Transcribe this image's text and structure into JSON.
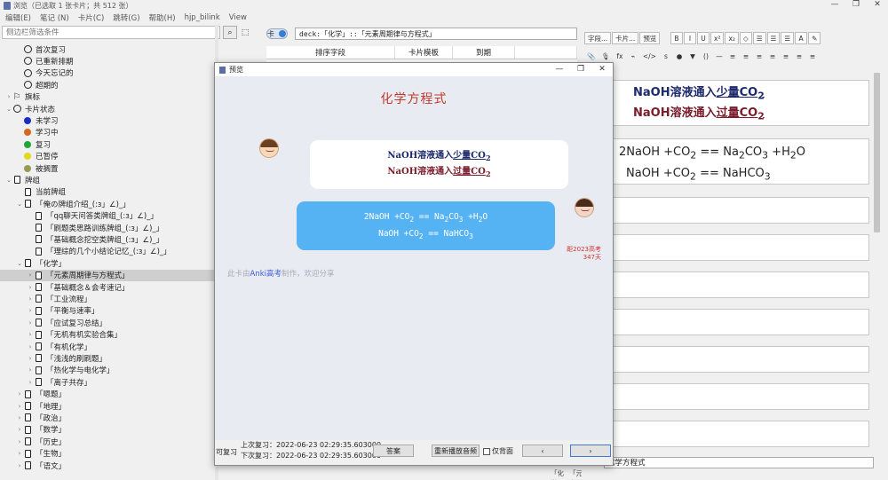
{
  "window": {
    "title": "浏览（已选取 1 张卡片；共 512 张）",
    "controls": [
      "—",
      "❐",
      "✕"
    ]
  },
  "menu": [
    "编辑(E)",
    "笔记 (N)",
    "卡片(C)",
    "跳转(G)",
    "帮助(H)",
    "hjp_bilink",
    "View"
  ],
  "search": {
    "placeholder": "侧边栏筛选条件"
  },
  "sidebar": {
    "items": [
      {
        "label": "首次复习",
        "icon": "clock-icon",
        "indent": 1
      },
      {
        "label": "已重新排期",
        "icon": "clock-icon",
        "indent": 1
      },
      {
        "label": "今天忘记的",
        "icon": "clock-icon",
        "indent": 1
      },
      {
        "label": "超期的",
        "icon": "clock-icon",
        "indent": 1
      },
      {
        "label": "旗标",
        "icon": "flag-icon",
        "indent": 0,
        "arrow": "›"
      },
      {
        "label": "卡片状态",
        "icon": "circle-icon",
        "indent": 0,
        "arrow": "⌄"
      },
      {
        "label": "未学习",
        "icon": "dot",
        "color": "#1a2fbf",
        "indent": 1
      },
      {
        "label": "学习中",
        "icon": "dot",
        "color": "#d9661f",
        "indent": 1
      },
      {
        "label": "复习",
        "icon": "dot",
        "color": "#1fa83a",
        "indent": 1
      },
      {
        "label": "已暂停",
        "icon": "dot",
        "color": "#e3d81a",
        "indent": 1
      },
      {
        "label": "被搁置",
        "icon": "dot",
        "color": "#9a9a55",
        "indent": 1
      },
      {
        "label": "牌组",
        "icon": "deck-icon",
        "indent": 0,
        "arrow": "⌄"
      },
      {
        "label": "当前牌组",
        "icon": "current-deck-icon",
        "indent": 1
      },
      {
        "label": "「俺の牌组介绍_(:з」∠)_」",
        "icon": "deck-icon",
        "indent": 1,
        "arrow": "⌄"
      },
      {
        "label": "「qq聊天问答类牌组_(:з」∠)_」",
        "icon": "deck-icon",
        "indent": 2
      },
      {
        "label": "「刷题类思路训练牌组_(:з」∠)_」",
        "icon": "deck-icon",
        "indent": 2
      },
      {
        "label": "「基础概念挖空类牌组_(:з」∠)_」",
        "icon": "deck-icon",
        "indent": 2
      },
      {
        "label": "「理综的几个小结论记忆_(:з」∠)_」",
        "icon": "deck-icon",
        "indent": 2
      },
      {
        "label": "「化学」",
        "icon": "deck-icon",
        "indent": 1,
        "arrow": "⌄"
      },
      {
        "label": "「元素周期律与方程式」",
        "icon": "deck-icon",
        "indent": 2,
        "arrow": "›",
        "selected": true
      },
      {
        "label": "「基础概念＆会考速记」",
        "icon": "deck-icon",
        "indent": 2,
        "arrow": "›"
      },
      {
        "label": "「工业流程」",
        "icon": "deck-icon",
        "indent": 2,
        "arrow": "›"
      },
      {
        "label": "「平衡与速率」",
        "icon": "deck-icon",
        "indent": 2,
        "arrow": "›"
      },
      {
        "label": "「应试复习总结」",
        "icon": "deck-icon",
        "indent": 2,
        "arrow": "›"
      },
      {
        "label": "「无机有机实验合集」",
        "icon": "deck-icon",
        "indent": 2,
        "arrow": "›"
      },
      {
        "label": "「有机化学」",
        "icon": "deck-icon",
        "indent": 2,
        "arrow": "›"
      },
      {
        "label": "「浅浅的刷刷题」",
        "icon": "deck-icon",
        "indent": 2,
        "arrow": "›"
      },
      {
        "label": "「热化学与电化学」",
        "icon": "deck-icon",
        "indent": 2,
        "arrow": "›"
      },
      {
        "label": "「离子共存」",
        "icon": "deck-icon",
        "indent": 2,
        "arrow": "›"
      },
      {
        "label": "「嗯题」",
        "icon": "deck-icon",
        "indent": 1,
        "arrow": "›"
      },
      {
        "label": "「地理」",
        "icon": "deck-icon",
        "indent": 1,
        "arrow": "›"
      },
      {
        "label": "「政治」",
        "icon": "deck-icon",
        "indent": 1,
        "arrow": "›"
      },
      {
        "label": "「数学」",
        "icon": "deck-icon",
        "indent": 1,
        "arrow": "›"
      },
      {
        "label": "「历史」",
        "icon": "deck-icon",
        "indent": 1,
        "arrow": "›"
      },
      {
        "label": "「生物」",
        "icon": "deck-icon",
        "indent": 1,
        "arrow": "›"
      },
      {
        "label": "「语文」",
        "icon": "deck-icon",
        "indent": 1,
        "arrow": "›"
      }
    ]
  },
  "browser": {
    "toggle_label": "卡",
    "deck_query": "deck:「化学」::「元素周期律与方程式」",
    "columns": [
      "排序字段",
      "卡片模板",
      "到期"
    ],
    "bottom_row": [
      "「化学」",
      "「元素"
    ]
  },
  "editor": {
    "toolbar_buttons": [
      "字段...",
      "卡片...",
      "预览"
    ],
    "format_buttons": [
      "B",
      "I",
      "U",
      "x²",
      "x₂",
      "◇",
      "☰",
      "☰",
      "☰",
      "A",
      "✎"
    ],
    "toolbar2": [
      "📎",
      "🎙",
      "fx",
      "⌁",
      "</>",
      "s",
      "●",
      "▼",
      "()",
      "—",
      "≡",
      "≡",
      "≡",
      "≡",
      "≡",
      "≡",
      "≡"
    ],
    "field_labels": [
      "0",
      "1",
      "2",
      "3",
      "4",
      "5",
      "6",
      "7",
      "8"
    ],
    "tags_label": "标签",
    "tags_value": "化学方程式"
  },
  "preview": {
    "title": "预览",
    "card_title": "化学方程式",
    "q_line1": "NaOH溶液通入",
    "q_line1_u": "少量",
    "q_line2": "NaOH溶液通入",
    "q_line2_u": "过量",
    "co2": "CO",
    "a_line1_left": "2NaOH +CO",
    "a_line1_mid": " == Na",
    "a_line1_co": "CO",
    "a_line1_right": " +H",
    "a_line1_end": "O",
    "a_line2_left": "NaOH +CO",
    "a_line2_mid": " == NaHCO",
    "sub2": "2",
    "sub3": "3",
    "countdown_line1": "距2023高考",
    "countdown_line2": "347天",
    "footnote_prefix": "此卡由",
    "footnote_link": "Anki高考",
    "footnote_suffix": "制作，欢迎分享",
    "left_label": "可复习",
    "last_review": "上次复习：2022-06-23 02:29:35.603000",
    "next_review": "下次复习：2022-06-23 02:29:35.603000",
    "answer_btn": "答案",
    "replay_btn": "重新播放音频",
    "front_only": "仅背面",
    "prev_btn": "‹",
    "next_btn": "›"
  }
}
